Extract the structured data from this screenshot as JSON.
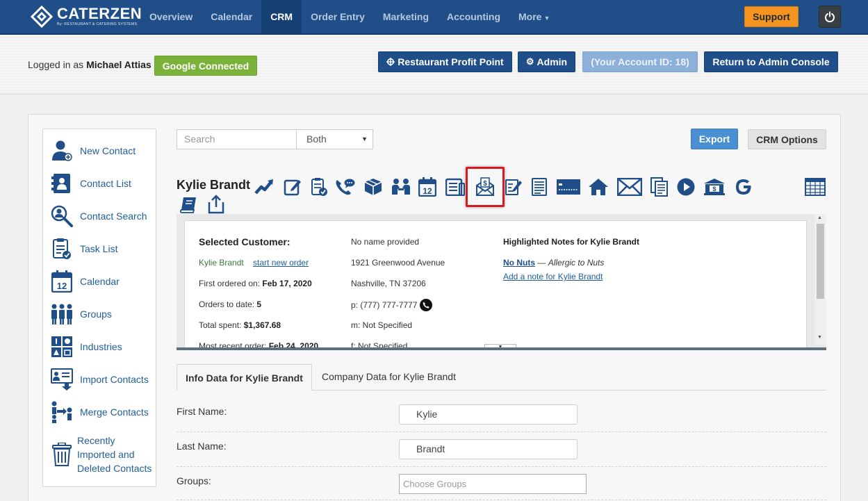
{
  "brand": {
    "name": "CATERZEN",
    "tagline": "By: RESTAURANT & CATERING SYSTEMS"
  },
  "nav": {
    "items": [
      {
        "label": "Overview",
        "active": false
      },
      {
        "label": "Calendar",
        "active": false
      },
      {
        "label": "CRM",
        "active": true
      },
      {
        "label": "Order Entry",
        "active": false
      },
      {
        "label": "Marketing",
        "active": false
      },
      {
        "label": "Accounting",
        "active": false
      },
      {
        "label": "More",
        "active": false
      }
    ],
    "support_label": "Support"
  },
  "header": {
    "logged_in_prefix": "Logged in as",
    "user_name": "Michael Attias",
    "google_label": "Google Connected",
    "profit_point_label": "Restaurant Profit Point",
    "admin_label": "Admin",
    "account_id_label": "(Your Account ID: 18)",
    "return_label": "Return to Admin Console"
  },
  "sidebar": {
    "items": [
      {
        "label": "New Contact",
        "icon": "new-contact-icon"
      },
      {
        "label": "Contact List",
        "icon": "contact-list-icon"
      },
      {
        "label": "Contact Search",
        "icon": "contact-search-icon"
      },
      {
        "label": "Task List",
        "icon": "task-list-icon"
      },
      {
        "label": "Calendar",
        "icon": "calendar-icon"
      },
      {
        "label": "Groups",
        "icon": "groups-icon"
      },
      {
        "label": "Industries",
        "icon": "industries-icon"
      },
      {
        "label": "Import Contacts",
        "icon": "import-contacts-icon"
      },
      {
        "label": "Merge Contacts",
        "icon": "merge-contacts-icon"
      },
      {
        "label": "Recently Imported and Deleted Contacts",
        "icon": "trash-icon"
      }
    ]
  },
  "search": {
    "placeholder": "Search",
    "scope": "Both"
  },
  "toolbar": {
    "export_label": "Export",
    "crm_options_label": "CRM Options",
    "calendar_day": "12"
  },
  "customer": {
    "name": "Kylie Brandt",
    "selected_label": "Selected Customer:",
    "link_name": "Kylie Brandt",
    "new_order_link": "start new order",
    "first_ordered_label": "First ordered on:",
    "first_ordered_value": "Feb 17, 2020",
    "orders_label": "Orders to date:",
    "orders_value": "5",
    "spent_label": "Total spent:",
    "spent_value": "$1,367.68",
    "recent_label": "Most recent order:",
    "recent_value": "Feb 24, 2020",
    "company": "No name provided",
    "address1": "1921 Greenwood Avenue",
    "address2": "Nashville, TN 37206",
    "phone": "p: (777) 777-7777",
    "mobile": "m: Not Specified",
    "fax": "f: Not Specified",
    "notes_title": "Highlighted Notes for Kylie Brandt",
    "note_title": "No Nuts",
    "note_separator": "—",
    "note_text": "Allergic to Nuts",
    "add_note_link": "Add a note for Kylie Brandt"
  },
  "tabs": [
    {
      "label": "Info Data for Kylie Brandt",
      "active": true
    },
    {
      "label": "Company Data for Kylie Brandt",
      "active": false
    }
  ],
  "form": {
    "first_name_label": "First Name:",
    "first_name_value": "Kylie",
    "last_name_label": "Last Name:",
    "last_name_value": "Brandt",
    "groups_label": "Groups:",
    "groups_placeholder": "Choose Groups"
  },
  "colors": {
    "nav_bg": "#1f4e89",
    "support": "#f5941f",
    "google": "#7bb33a",
    "export": "#4a8fd1",
    "highlight": "#d71920"
  }
}
